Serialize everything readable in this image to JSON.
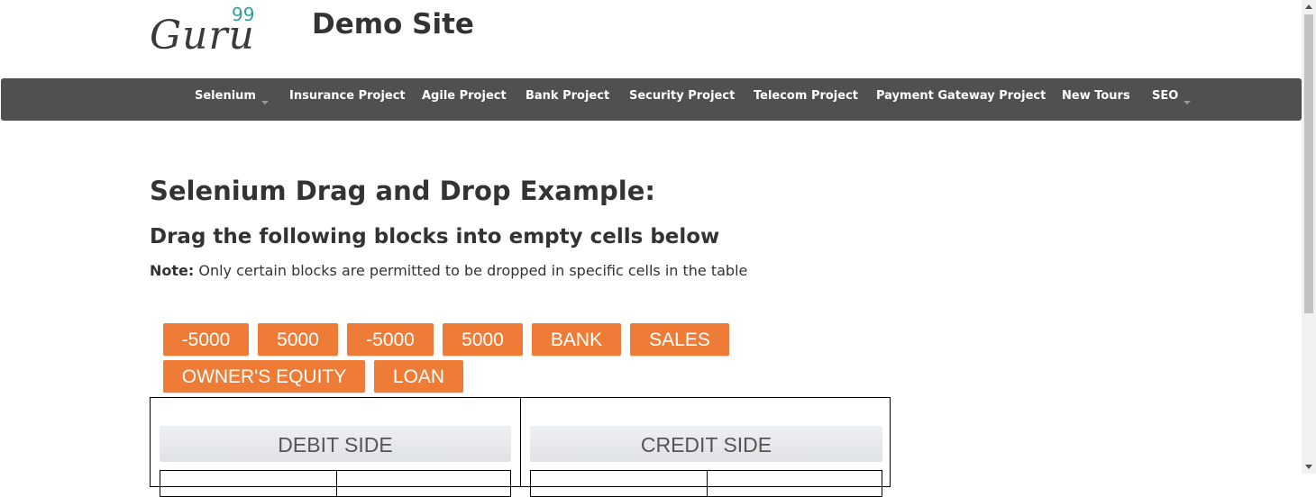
{
  "header": {
    "logo_text": "Guru",
    "logo_superscript": "99",
    "site_title": "Demo Site"
  },
  "navbar": {
    "items": [
      {
        "label": "Selenium",
        "dropdown": true
      },
      {
        "label": "Insurance Project",
        "dropdown": false
      },
      {
        "label": "Agile Project",
        "dropdown": false
      },
      {
        "label": "Bank Project",
        "dropdown": false
      },
      {
        "label": "Security Project",
        "dropdown": false
      },
      {
        "label": "Telecom Project",
        "dropdown": false
      },
      {
        "label": "Payment Gateway Project",
        "dropdown": false
      },
      {
        "label": "New Tours",
        "dropdown": false
      },
      {
        "label": "SEO",
        "dropdown": true
      }
    ]
  },
  "main": {
    "title": "Selenium Drag and Drop Example:",
    "subtitle": "Drag the following blocks into empty cells below",
    "note_label": "Note:",
    "note_text": " Only certain blocks are permitted to be dropped in specific cells in the table",
    "blocks": [
      "-5000",
      "5000",
      "-5000",
      "5000",
      "BANK",
      "SALES",
      "OWNER'S EQUITY",
      "LOAN"
    ],
    "debit_header": "DEBIT SIDE",
    "credit_header": "CREDIT SIDE"
  },
  "colors": {
    "navbar_bg": "#505050",
    "block_bg": "#ee7c36",
    "logo_accent": "#2f9fa3"
  },
  "icons": {
    "dropdown": "caret-down-icon"
  }
}
